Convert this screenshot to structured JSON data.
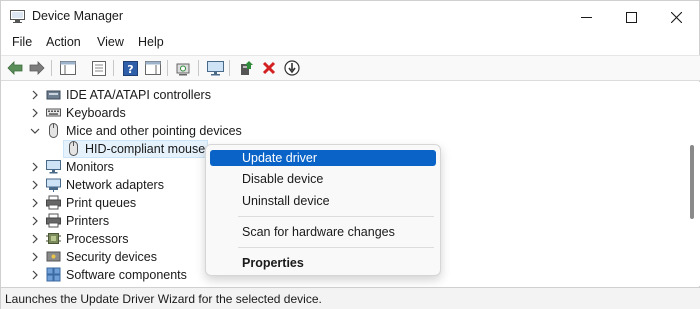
{
  "window": {
    "title": "Device Manager",
    "app_icon": "device-manager-icon"
  },
  "menubar": {
    "items": [
      "File",
      "Action",
      "View",
      "Help"
    ]
  },
  "toolbar": {
    "buttons": [
      "back-icon",
      "forward-icon",
      "show-hide-console-tree-icon",
      "properties-icon",
      "help-icon",
      "action-pane-icon",
      "scan-hardware-icon",
      "monitor-icon",
      "update-driver-icon",
      "uninstall-icon",
      "disable-device-icon"
    ]
  },
  "tree": {
    "items": [
      {
        "label": "IDE ATA/ATAPI controllers",
        "icon": "ide-controller-icon",
        "expanded": false
      },
      {
        "label": "Keyboards",
        "icon": "keyboard-icon",
        "expanded": false
      },
      {
        "label": "Mice and other pointing devices",
        "icon": "mouse-icon",
        "expanded": true
      },
      {
        "label": "HID-compliant mouse",
        "icon": "mouse-icon",
        "child": true,
        "selected": true
      },
      {
        "label": "Monitors",
        "icon": "monitor-icon",
        "expanded": false
      },
      {
        "label": "Network adapters",
        "icon": "network-adapter-icon",
        "expanded": false
      },
      {
        "label": "Print queues",
        "icon": "printer-icon",
        "expanded": false
      },
      {
        "label": "Printers",
        "icon": "printer-icon",
        "expanded": false
      },
      {
        "label": "Processors",
        "icon": "processor-icon",
        "expanded": false
      },
      {
        "label": "Security devices",
        "icon": "security-device-icon",
        "expanded": false
      },
      {
        "label": "Software components",
        "icon": "software-component-icon",
        "expanded": false
      }
    ]
  },
  "context_menu": {
    "items": [
      {
        "label": "Update driver",
        "highlighted": true
      },
      {
        "label": "Disable device"
      },
      {
        "label": "Uninstall device"
      },
      {
        "label": "Scan for hardware changes"
      },
      {
        "label": "Properties",
        "bold": true
      }
    ]
  },
  "statusbar": {
    "text": "Launches the Update Driver Wizard for the selected device."
  },
  "colors": {
    "highlight": "#0a64c8",
    "selection": "#e5f1fb",
    "close_red": "#d32020",
    "update_green": "#2e8b3a"
  }
}
